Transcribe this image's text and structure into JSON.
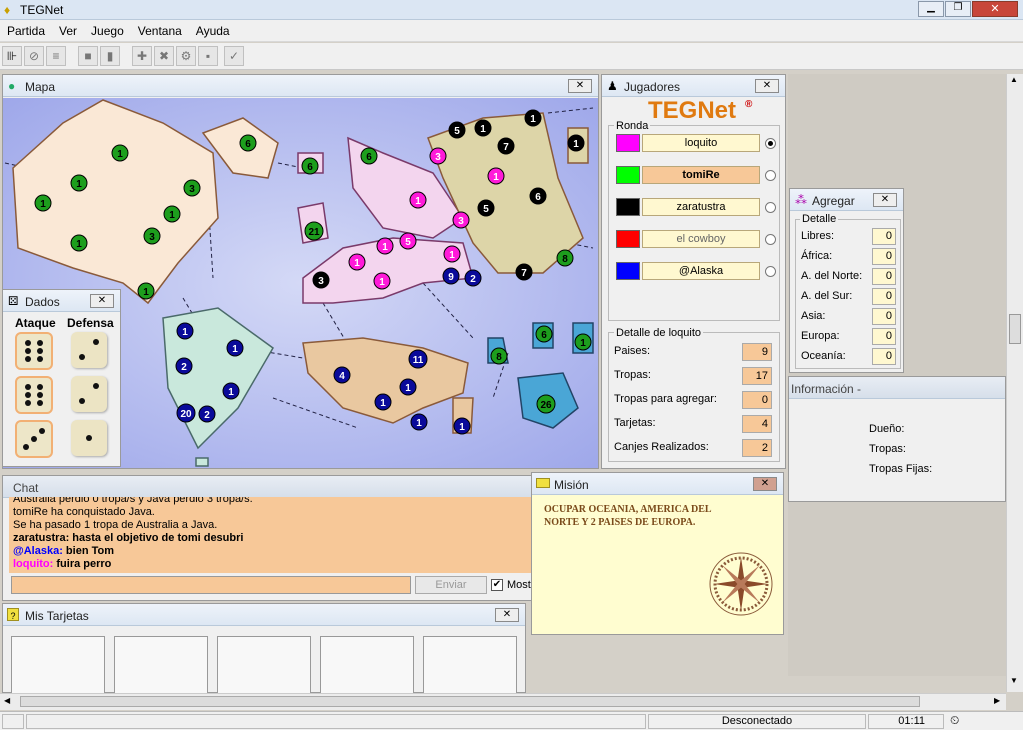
{
  "app_title": "TEGNet",
  "menu": [
    "Partida",
    "Ver",
    "Juego",
    "Ventana",
    "Ayuda"
  ],
  "map": {
    "title": "Mapa"
  },
  "players_panel": {
    "title": "Jugadores",
    "logo": "TEGNet",
    "logo_mark": "®",
    "ronda_label": "Ronda",
    "players": [
      {
        "name": "loquito",
        "color": "#ff00ff",
        "selected": true
      },
      {
        "name": "tomiRe",
        "color": "#00ff00",
        "selected": false
      },
      {
        "name": "zaratustra",
        "color": "#000000",
        "selected": false
      },
      {
        "name": "el cowboy",
        "color": "#ff0000",
        "selected": false
      },
      {
        "name": "@Alaska",
        "color": "#0000ff",
        "selected": false
      }
    ],
    "detail_title": "Detalle de loquito",
    "detail": [
      {
        "label": "Paises:",
        "value": "9"
      },
      {
        "label": "Tropas:",
        "value": "17"
      },
      {
        "label": "Tropas para agregar:",
        "value": "0"
      },
      {
        "label": "Tarjetas:",
        "value": "4"
      },
      {
        "label": "Canjes Realizados:",
        "value": "2"
      }
    ]
  },
  "agregar": {
    "title": "Agregar",
    "detalle_label": "Detalle",
    "rows": [
      {
        "label": "Libres:",
        "value": "0"
      },
      {
        "label": "África:",
        "value": "0"
      },
      {
        "label": "A. del Norte:",
        "value": "0"
      },
      {
        "label": "A. del Sur:",
        "value": "0"
      },
      {
        "label": "Asia:",
        "value": "0"
      },
      {
        "label": "Europa:",
        "value": "0"
      },
      {
        "label": "Oceanía:",
        "value": "0"
      }
    ]
  },
  "info": {
    "title": "Información -",
    "owner_label": "Dueño:",
    "troops_label": "Tropas:",
    "fixed_label": "Tropas Fijas:"
  },
  "dice": {
    "title": "Dados",
    "attack_label": "Ataque",
    "defense_label": "Defensa",
    "attack": [
      6,
      6,
      3
    ],
    "defense": [
      2,
      2,
      1
    ]
  },
  "chat": {
    "title": "Chat",
    "lines": [
      {
        "text": "Australia perdió 0 tropa/s y Java perdió 3 tropa/s.",
        "bold": false,
        "nick": "",
        "color": "#000"
      },
      {
        "text": "tomiRe ha conquistado Java.",
        "bold": false,
        "nick": "",
        "color": "#000"
      },
      {
        "text": "Se ha pasado 1 tropa de Australia a Java.",
        "bold": false,
        "nick": "",
        "color": "#000"
      },
      {
        "text": " hasta el objetivo de tomi desubri",
        "bold": true,
        "nick": "zaratustra:",
        "color": "#000"
      },
      {
        "text": " bien Tom",
        "bold": true,
        "nick": "@Alaska:",
        "color": "#0000ff"
      },
      {
        "text": " fuira perro",
        "bold": true,
        "nick": "loquito:",
        "color": "#ff00ff"
      }
    ],
    "send_label": "Enviar",
    "show_label": "Most"
  },
  "mission": {
    "title": "Misión",
    "text": "OCUPAR OCEANIA, AMERICA DEL NORTE Y 2 PAISES DE EUROPA."
  },
  "cards": {
    "title": "Mis Tarjetas"
  },
  "status": {
    "connection": "Desconectado",
    "time": "01:11"
  }
}
